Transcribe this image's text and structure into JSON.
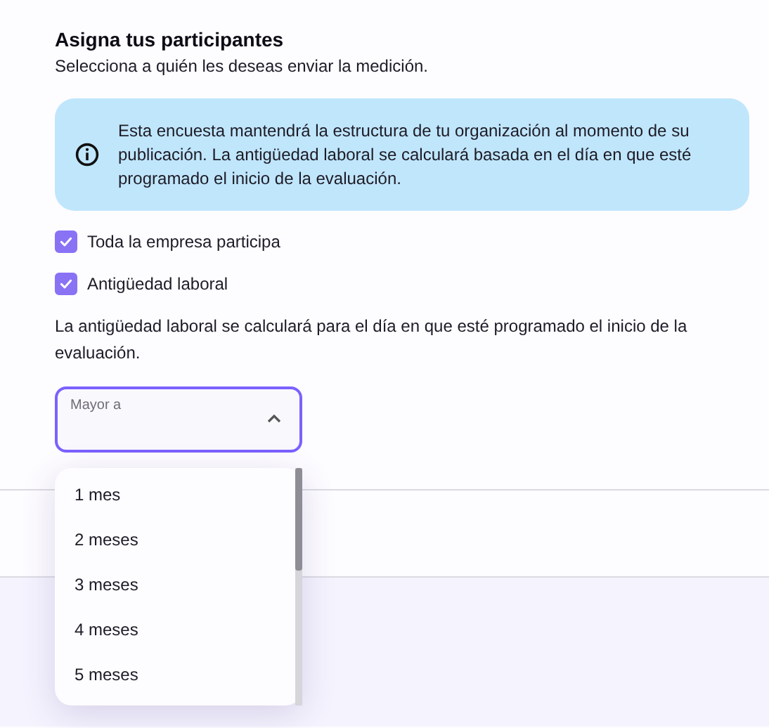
{
  "heading": "Asigna tus participantes",
  "subheading": "Selecciona a quién les deseas enviar la medición.",
  "info": "Esta encuesta mantendrá la estructura de tu organización al momento de su publicación. La antigüedad laboral se calculará basada en el día en que esté programado el inicio de la evaluación.",
  "options": [
    {
      "label": "Toda la empresa participa",
      "checked": true
    },
    {
      "label": "Antigüedad laboral",
      "checked": true
    }
  ],
  "note": "La antigüedad laboral se calculará para el día en que esté programado el inicio de la evaluación.",
  "select": {
    "label": "Mayor a",
    "expanded": true,
    "options": [
      {
        "label": "1 mes"
      },
      {
        "label": "2 meses"
      },
      {
        "label": "3 meses"
      },
      {
        "label": "4 meses"
      },
      {
        "label": "5 meses"
      }
    ]
  }
}
